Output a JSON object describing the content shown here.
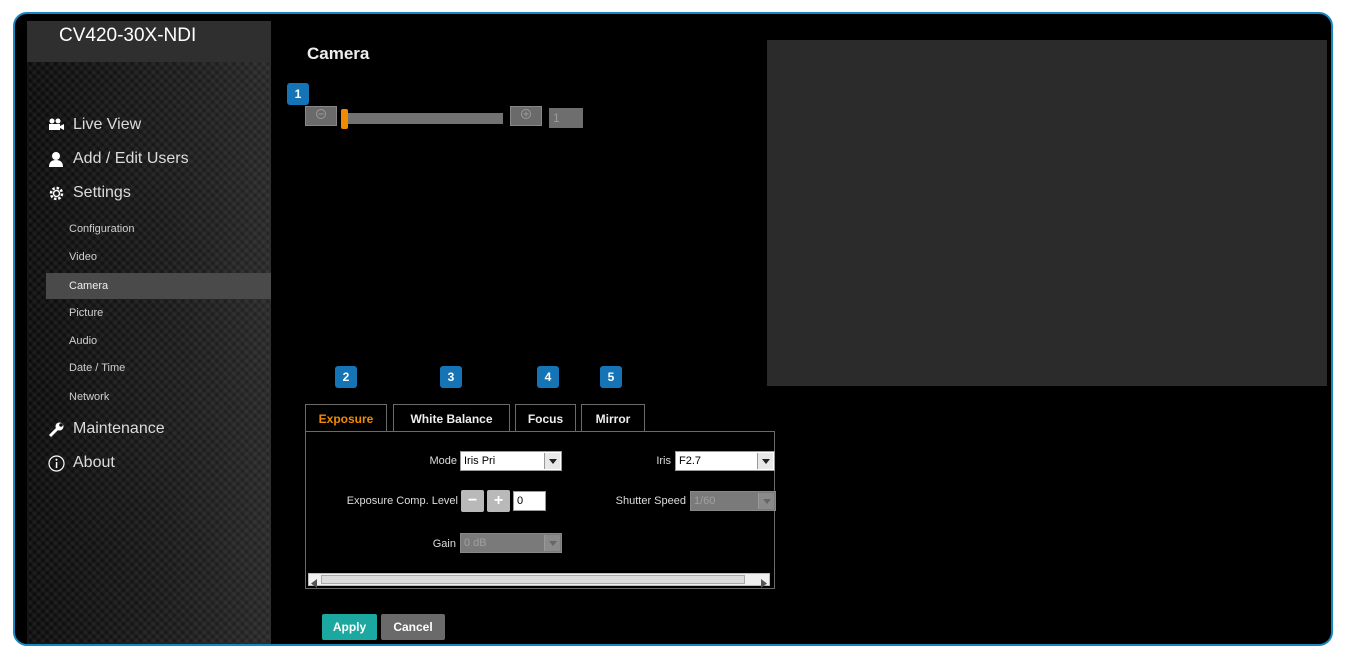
{
  "brand": "CV420-30X-NDI",
  "nav": {
    "live_view": "Live View",
    "add_edit_users": "Add / Edit Users",
    "settings": "Settings",
    "maintenance": "Maintenance",
    "about": "About"
  },
  "settings_items": [
    "Configuration",
    "Video",
    "Camera",
    "Picture",
    "Audio",
    "Date / Time",
    "Network"
  ],
  "active_settings_item": "Camera",
  "page_title": "Camera",
  "badges": [
    "1",
    "2",
    "3",
    "4",
    "5"
  ],
  "zoom": {
    "value": "1",
    "slider_fraction": 0.0
  },
  "tabs": [
    "Exposure",
    "White Balance",
    "Focus",
    "Mirror"
  ],
  "active_tab": "Exposure",
  "exposure": {
    "mode_label": "Mode",
    "mode_value": "Iris Pri",
    "iris_label": "Iris",
    "iris_value": "F2.7",
    "comp_label": "Exposure Comp. Level",
    "comp_minus": "−",
    "comp_plus": "+",
    "comp_value": "0",
    "shutter_label": "Shutter Speed",
    "shutter_value": "1/60",
    "gain_label": "Gain",
    "gain_value": "0 dB"
  },
  "buttons": {
    "apply": "Apply",
    "cancel": "Cancel"
  },
  "colors": {
    "accent_blue": "#1574b5",
    "active_orange": "#f08a00",
    "apply_teal": "#1aa8a0",
    "frame_border": "#1a86c0"
  }
}
